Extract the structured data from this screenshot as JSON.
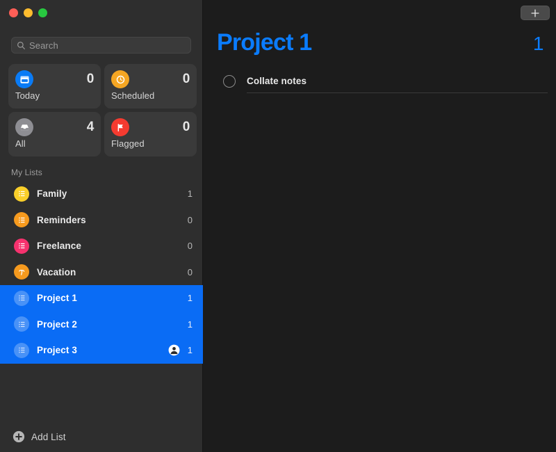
{
  "window": {
    "traffic_lights": [
      {
        "name": "close",
        "color": "#ff5f57"
      },
      {
        "name": "minimize",
        "color": "#febc2e"
      },
      {
        "name": "zoom",
        "color": "#28c840"
      }
    ]
  },
  "search": {
    "placeholder": "Search",
    "value": "",
    "icon": "search-icon"
  },
  "smart_lists": [
    {
      "id": "today",
      "label": "Today",
      "count": "0",
      "icon": "calendar-today-icon",
      "color": "#0a7bf5"
    },
    {
      "id": "scheduled",
      "label": "Scheduled",
      "count": "0",
      "icon": "clock-icon",
      "color": "#f5a623"
    },
    {
      "id": "all",
      "label": "All",
      "count": "4",
      "icon": "inbox-tray-icon",
      "color": "#8e8e93"
    },
    {
      "id": "flagged",
      "label": "Flagged",
      "count": "0",
      "icon": "flag-icon",
      "color": "#f53b30"
    }
  ],
  "sidebar": {
    "section_title": "My Lists",
    "lists": [
      {
        "name": "Family",
        "count": "1",
        "color": "#f9cf2a",
        "icon": "list-lines-icon",
        "selected": false,
        "shared": false
      },
      {
        "name": "Reminders",
        "count": "0",
        "color": "#f69a1e",
        "icon": "list-lines-icon",
        "selected": false,
        "shared": false
      },
      {
        "name": "Freelance",
        "count": "0",
        "color": "#f5326e",
        "icon": "list-lines-icon",
        "selected": false,
        "shared": false
      },
      {
        "name": "Vacation",
        "count": "0",
        "color": "#f69a1e",
        "icon": "palm-tree-icon",
        "selected": false,
        "shared": false
      },
      {
        "name": "Project 1",
        "count": "1",
        "color": "#0a6cf5",
        "icon": "list-lines-icon",
        "selected": true,
        "shared": false
      },
      {
        "name": "Project 2",
        "count": "1",
        "color": "#0a6cf5",
        "icon": "list-lines-icon",
        "selected": true,
        "shared": false
      },
      {
        "name": "Project 3",
        "count": "1",
        "color": "#0a6cf5",
        "icon": "list-lines-icon",
        "selected": true,
        "shared": true,
        "shared_icon": "person-circle-icon"
      }
    ],
    "add_list": {
      "label": "Add List",
      "icon": "plus-circle-icon"
    }
  },
  "main": {
    "add_button": {
      "icon": "plus-icon",
      "label": ""
    },
    "title": "Project 1",
    "count": "1",
    "accent_color": "#0a7cff",
    "tasks": [
      {
        "title": "Collate notes",
        "completed": false,
        "checkbox": "circle-empty-icon"
      }
    ]
  }
}
